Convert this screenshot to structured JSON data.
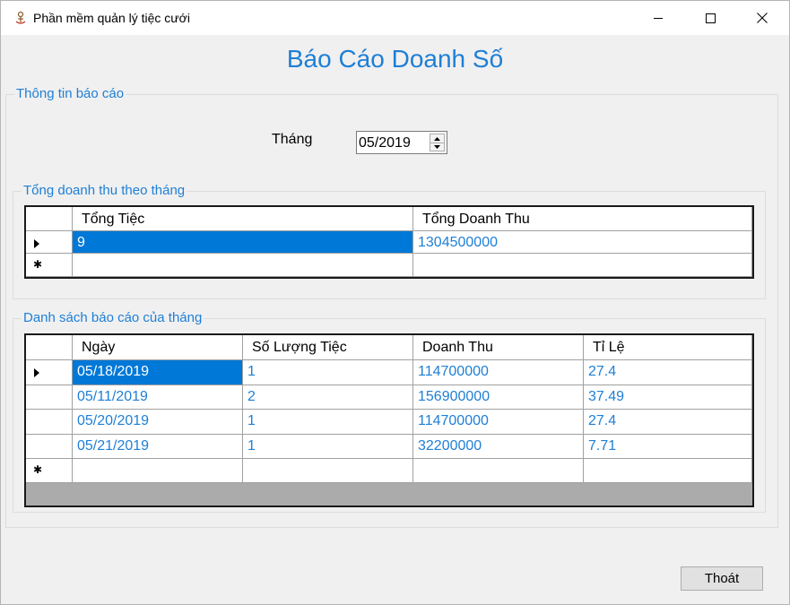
{
  "window": {
    "title": "Phần mềm quản lý tiệc cưới",
    "icon": "wedding-app-icon",
    "controls": [
      "minimize",
      "maximize",
      "close"
    ]
  },
  "heading": "Báo Cáo Doanh Số",
  "info_group": {
    "title": "Thông tin báo cáo",
    "month_label": "Tháng",
    "month_value": "05/2019"
  },
  "total_group": {
    "title": "Tổng doanh thu theo tháng",
    "columns": [
      "Tổng Tiệc",
      "Tổng Doanh Thu"
    ],
    "rows": [
      {
        "tong_tiec": "9",
        "tong_doanh_thu": "1304500000"
      }
    ]
  },
  "list_group": {
    "title": "Danh sách báo cáo của tháng",
    "columns": [
      "Ngày",
      "Số Lượng Tiệc",
      "Doanh Thu",
      "Tỉ Lệ"
    ],
    "rows": [
      {
        "ngay": "05/18/2019",
        "so_luong": "1",
        "doanh_thu": "114700000",
        "ti_le": "27.4"
      },
      {
        "ngay": "05/11/2019",
        "so_luong": "2",
        "doanh_thu": "156900000",
        "ti_le": "37.49"
      },
      {
        "ngay": "05/20/2019",
        "so_luong": "1",
        "doanh_thu": "114700000",
        "ti_le": "27.4"
      },
      {
        "ngay": "05/21/2019",
        "so_luong": "1",
        "doanh_thu": "32200000",
        "ti_le": "7.71"
      }
    ]
  },
  "exit_button": "Thoát",
  "colors": {
    "accent": "#1e7fd6",
    "selection": "#0078d7",
    "background": "#f0f0f0"
  }
}
